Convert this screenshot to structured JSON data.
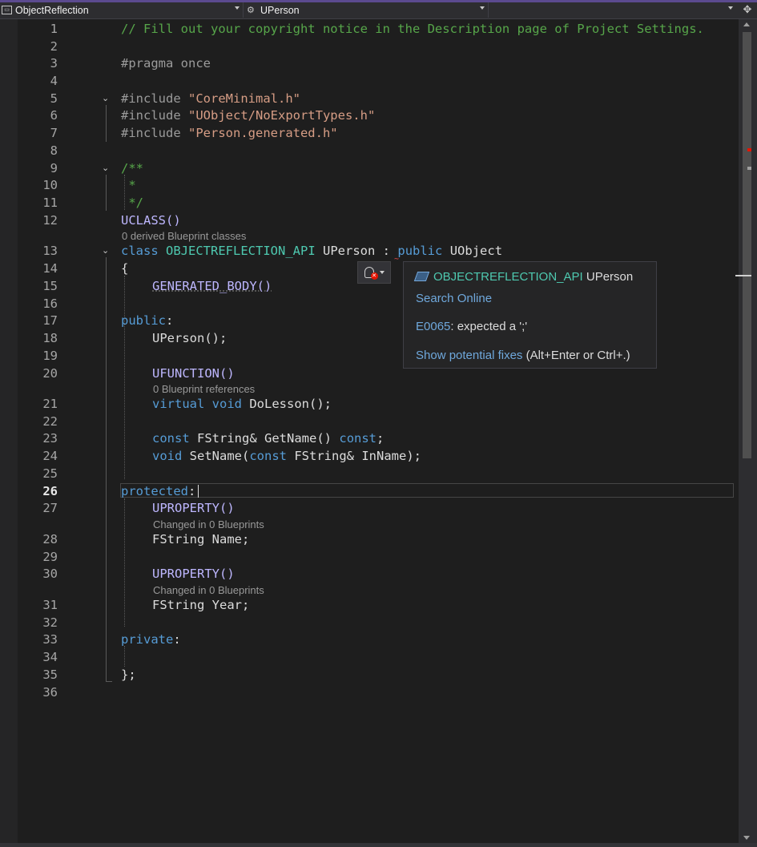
{
  "navbar": {
    "project": "ObjectReflection",
    "symbol": "UPerson",
    "member": ""
  },
  "lines": [
    {
      "n": "1"
    },
    {
      "n": "2"
    },
    {
      "n": "3"
    },
    {
      "n": "4"
    },
    {
      "n": "5"
    },
    {
      "n": "6"
    },
    {
      "n": "7"
    },
    {
      "n": "8"
    },
    {
      "n": "9"
    },
    {
      "n": "10"
    },
    {
      "n": "11"
    },
    {
      "n": "12"
    },
    {
      "n": "13"
    },
    {
      "n": "14"
    },
    {
      "n": "15"
    },
    {
      "n": "16"
    },
    {
      "n": "17"
    },
    {
      "n": "18"
    },
    {
      "n": "19"
    },
    {
      "n": "20"
    },
    {
      "n": "21"
    },
    {
      "n": "22"
    },
    {
      "n": "23"
    },
    {
      "n": "24"
    },
    {
      "n": "25"
    },
    {
      "n": "26"
    },
    {
      "n": "27"
    },
    {
      "n": "28"
    },
    {
      "n": "29"
    },
    {
      "n": "30"
    },
    {
      "n": "31"
    },
    {
      "n": "32"
    },
    {
      "n": "33"
    },
    {
      "n": "34"
    },
    {
      "n": "35"
    },
    {
      "n": "36"
    }
  ],
  "code": {
    "l1": "// Fill out your copyright notice in the Description page of Project Settings.",
    "l3": "#pragma once",
    "l5_kw": "#include",
    "l5_str": "\"CoreMinimal.h\"",
    "l6_kw": "#include",
    "l6_str": "\"UObject/NoExportTypes.h\"",
    "l7_kw": "#include",
    "l7_str": "\"Person.generated.h\"",
    "l9": "/**",
    "l10": " *",
    "l11": " */",
    "l12": "UCLASS()",
    "l13_class": "class",
    "l13_api": "OBJECTREFLECTION_API",
    "l13_name": "UPerson",
    "l13_colon": ":",
    "l13_public": "public",
    "l13_base": "UObject",
    "l14": "{",
    "l15": "GENERATED_BODY()",
    "l17": "public",
    "l17_colon": ":",
    "l18": "UPerson();",
    "l20": "UFUNCTION()",
    "l21_virtual": "virtual",
    "l21_void": "void",
    "l21_rest": "DoLesson();",
    "l23_const": "const",
    "l23_type": "FString&",
    "l23_name": "GetName()",
    "l23_const2": "const",
    "l23_semi": ";",
    "l24_void": "void",
    "l24_name": "SetName(",
    "l24_const": "const",
    "l24_rest": "FString& InName);",
    "l26": "protected",
    "l26_colon": ":",
    "l27": "UPROPERTY()",
    "l28": "FString Name;",
    "l30": "UPROPERTY()",
    "l31": "FString Year;",
    "l33": "private",
    "l33_colon": ":",
    "l35": "};"
  },
  "codelens": {
    "derived": "0 derived Blueprint classes",
    "bp_refs": "0 Blueprint references",
    "changed_name": "Changed in 0 Blueprints",
    "changed_year": "Changed in 0 Blueprints"
  },
  "quickinfo": {
    "api": "OBJECTREFLECTION_API",
    "type": "UPerson",
    "search": "Search Online",
    "error_code": "E0065",
    "error_msg": ": expected a ';'",
    "fix_link": "Show potential fixes",
    "fix_keys": "(Alt+Enter or Ctrl+.)"
  },
  "colors": {
    "background": "#1e1e1e",
    "comment": "#57a64a",
    "keyword": "#569cd6",
    "string": "#d69d85",
    "macro": "#beb7ff",
    "error": "#f14c4c"
  }
}
